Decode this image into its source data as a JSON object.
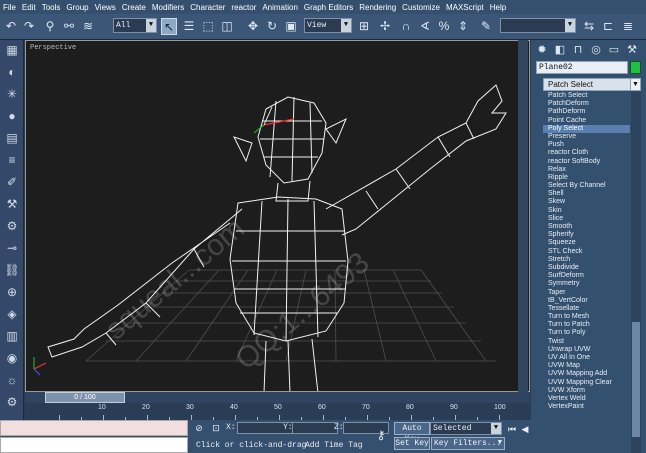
{
  "menu": [
    "File",
    "Edit",
    "Tools",
    "Group",
    "Views",
    "Create",
    "Modifiers",
    "Character",
    "reactor",
    "Animation",
    "Graph Editors",
    "Rendering",
    "Customize",
    "MAXScript",
    "Help"
  ],
  "toolbar": {
    "selection_filter": "All",
    "reference_coord": "View"
  },
  "viewport": {
    "label": "Perspective",
    "watermark": "squeal...com",
    "watermark_2": "QQ:1...6493"
  },
  "command_panel": {
    "object_name": "Plane02",
    "object_color": "#20c040",
    "modifier_list_selected": "Patch Select",
    "modifiers": [
      "Patch Select",
      "PatchDeform",
      "PathDeform",
      "Point Cache",
      "Poly Select",
      "Preserve",
      "Push",
      "reactor Cloth",
      "reactor SoftBody",
      "Relax",
      "Ripple",
      "Select By Channel",
      "Shell",
      "Skew",
      "Skin",
      "Slice",
      "Smooth",
      "Spherify",
      "Squeeze",
      "STL Check",
      "Stretch",
      "Subdivide",
      "SurfDeform",
      "Symmetry",
      "Taper",
      "tB_VertColor",
      "Tessellate",
      "Turn to Mesh",
      "Turn to Patch",
      "Turn to Poly",
      "Twist",
      "Unwrap UVW",
      "UV All In One",
      "UVW Map",
      "UVW Mapping Add",
      "UVW Mapping Clear",
      "UVW Xform",
      "Vertex Weld",
      "VertexPaint"
    ],
    "selected_modifier": "Poly Select"
  },
  "timeline": {
    "frame_display": "0 / 100",
    "ticks": [
      "10",
      "20",
      "30",
      "40",
      "50",
      "60",
      "70",
      "80",
      "90",
      "100"
    ]
  },
  "status": {
    "x_label": "X:",
    "y_label": "Y:",
    "z_label": "Z:",
    "prompt": "Click or click-and-drag",
    "add_time_tag": "Add Time Tag",
    "auto_key": "Auto Key",
    "key_mode": "Selected",
    "set_key": "Set Key",
    "key_filters": "Key Filters..."
  }
}
